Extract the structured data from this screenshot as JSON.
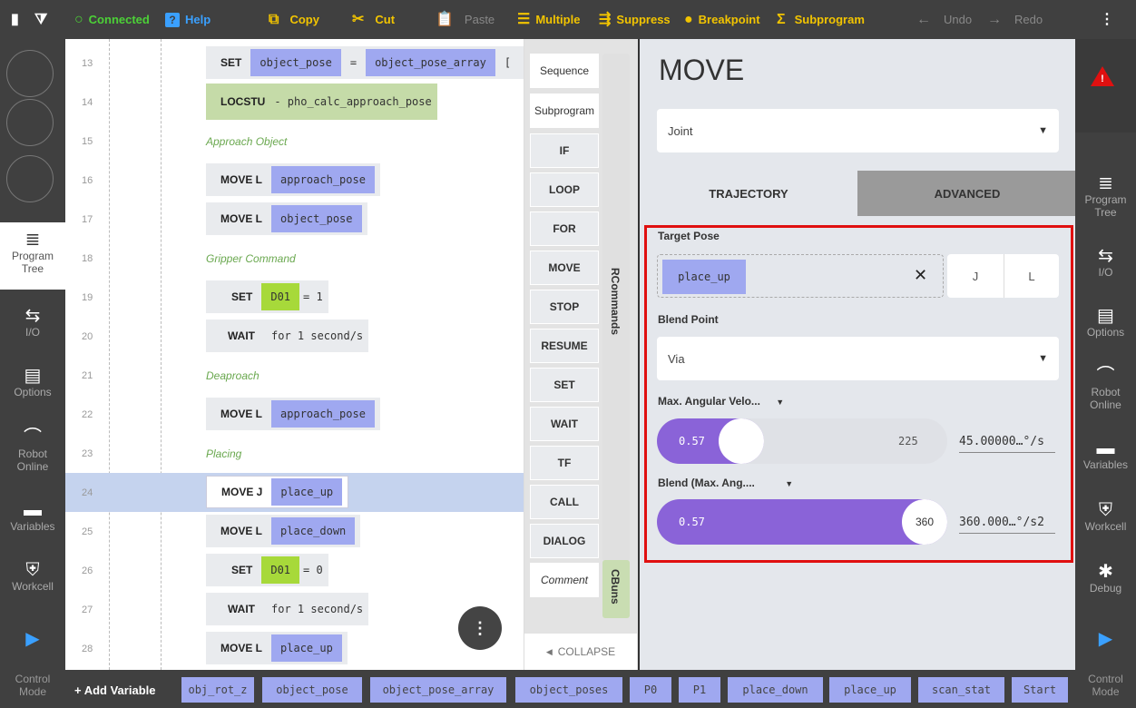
{
  "topbar": {
    "connected": "Connected",
    "help": "Help",
    "copy": "Copy",
    "cut": "Cut",
    "paste": "Paste",
    "multiple": "Multiple",
    "suppress": "Suppress",
    "breakpoint": "Breakpoint",
    "subprogram": "Subprogram",
    "undo": "Undo",
    "redo": "Redo"
  },
  "left_rail": {
    "items": [
      {
        "label": "Program Tree",
        "icon": "program-tree-icon"
      },
      {
        "label": "I/O",
        "icon": "io-icon"
      },
      {
        "label": "Options",
        "icon": "options-icon"
      },
      {
        "label": "Robot Online",
        "icon": "robot-icon"
      },
      {
        "label": "Variables",
        "icon": "variables-icon"
      },
      {
        "label": "Workcell",
        "icon": "workcell-icon"
      }
    ],
    "control_mode": "Control Mode"
  },
  "program": {
    "rows": [
      {
        "n": "13",
        "cmd": "SET",
        "a": "object_pose",
        "op": "=",
        "b": "object_pose_array",
        "tail": "["
      },
      {
        "n": "14",
        "cmd": "LOCSTU",
        "text": "- pho_calc_approach_pose"
      },
      {
        "n": "15",
        "comment": "Approach Object"
      },
      {
        "n": "16",
        "cmd": "MOVE L",
        "a": "approach_pose"
      },
      {
        "n": "17",
        "cmd": "MOVE L",
        "a": "object_pose"
      },
      {
        "n": "18",
        "comment": "Gripper Command"
      },
      {
        "n": "19",
        "cmd": "SET",
        "a": "D01",
        "text": "= 1"
      },
      {
        "n": "20",
        "cmd": "WAIT",
        "text": "for 1 second/s"
      },
      {
        "n": "21",
        "comment": "Deaproach"
      },
      {
        "n": "22",
        "cmd": "MOVE L",
        "a": "approach_pose"
      },
      {
        "n": "23",
        "comment": "Placing"
      },
      {
        "n": "24",
        "cmd": "MOVE J",
        "a": "place_up"
      },
      {
        "n": "25",
        "cmd": "MOVE L",
        "a": "place_down"
      },
      {
        "n": "26",
        "cmd": "SET",
        "a": "D01",
        "text": "= 0"
      },
      {
        "n": "27",
        "cmd": "WAIT",
        "text": "for 1 second/s"
      },
      {
        "n": "28",
        "cmd": "MOVE L",
        "a": "place_up"
      }
    ],
    "fab_icon": "more-vertical-icon"
  },
  "palette": {
    "buttons": [
      "Sequence",
      "Subprogram",
      "IF",
      "LOOP",
      "FOR",
      "MOVE",
      "STOP",
      "RESUME",
      "SET",
      "WAIT",
      "TF",
      "CALL",
      "DIALOG",
      "Comment"
    ],
    "rcommands": "RCommands",
    "cbuns": "CBuns",
    "collapse": "COLLAPSE"
  },
  "panel": {
    "title": "MOVE",
    "move_type": "Joint",
    "tabs": [
      "TRAJECTORY",
      "ADVANCED"
    ],
    "target_pose_label": "Target Pose",
    "target_pose_value": "place_up",
    "j_label": "J",
    "l_label": "L",
    "blend_point_label": "Blend Point",
    "blend_point_value": "Via",
    "max_ang_vel_label": "Max. Angular Velo...",
    "max_ang_vel_value": "0.57",
    "max_ang_vel_max": "225",
    "max_ang_vel_unit": "45.00000…°/s",
    "blend_label": "Blend (Max. Ang....",
    "blend_value": "0.57",
    "blend_max": "360",
    "blend_unit": "360.000…°/s2",
    "slider1_fraction": 0.25,
    "slider2_fraction": 1.0,
    "accent": "#8a63d8",
    "highlight_border": "#e01010"
  },
  "bottom": {
    "add_variable": "+ Add Variable",
    "variables": [
      "obj_rot_z",
      "object_pose",
      "object_pose_array",
      "object_poses",
      "P0",
      "P1",
      "place_down",
      "place_up",
      "scan_stat",
      "Start"
    ]
  }
}
